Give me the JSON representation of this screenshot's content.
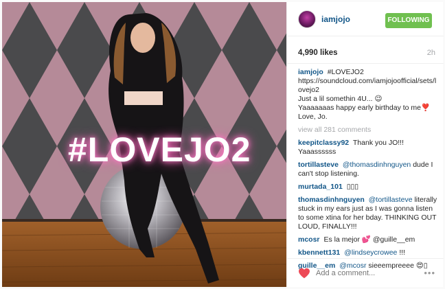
{
  "post": {
    "username": "iamjojo",
    "follow_label": "FOLLOWING",
    "likes": "4,990 likes",
    "time": "2h",
    "image_overlay_text": "#LOVEJO2"
  },
  "caption": {
    "user": "iamjojo",
    "text": "#LOVEJO2\nhttps://soundcloud.com/iamjojoofficial/sets/lovejo2\nJust a lil somethin 4U... 😉\nYaaaaaaas happy early birthday to me❣️\nLove, Jo."
  },
  "view_all": "view all 281 comments",
  "comments": [
    {
      "user": "keepitclassy92",
      "mention": "",
      "text": "Thank you JO!!! Yaaassssss"
    },
    {
      "user": "tortillasteve",
      "mention": "@thomasdinhnguyen",
      "text": "dude I can't stop listening."
    },
    {
      "user": "murtada_101",
      "mention": "",
      "text": "▯▯▯"
    },
    {
      "user": "thomasdinhnguyen",
      "mention": "@tortillasteve",
      "text": "literally stuck in my ears just as I was gonna listen to some xtina for her bday. THINKING OUT LOUD, FINALLY!!!"
    },
    {
      "user": "mcosr",
      "mention": "",
      "text": "Es la mejor 💕 @guille__em"
    },
    {
      "user": "kbennett131",
      "mention": "@lindseycrowee",
      "text": "!!!"
    },
    {
      "user": "guille__em",
      "mention": "@mcosr",
      "text": "sieeempreeee 😍▯"
    }
  ],
  "footer": {
    "placeholder": "Add a comment...",
    "more": "•••"
  },
  "colors": {
    "follow_green": "#70c050",
    "link_blue": "#125688",
    "heart_red": "#ed4956"
  },
  "icons": {
    "heart": "heart-icon",
    "more": "ellipsis-icon"
  }
}
